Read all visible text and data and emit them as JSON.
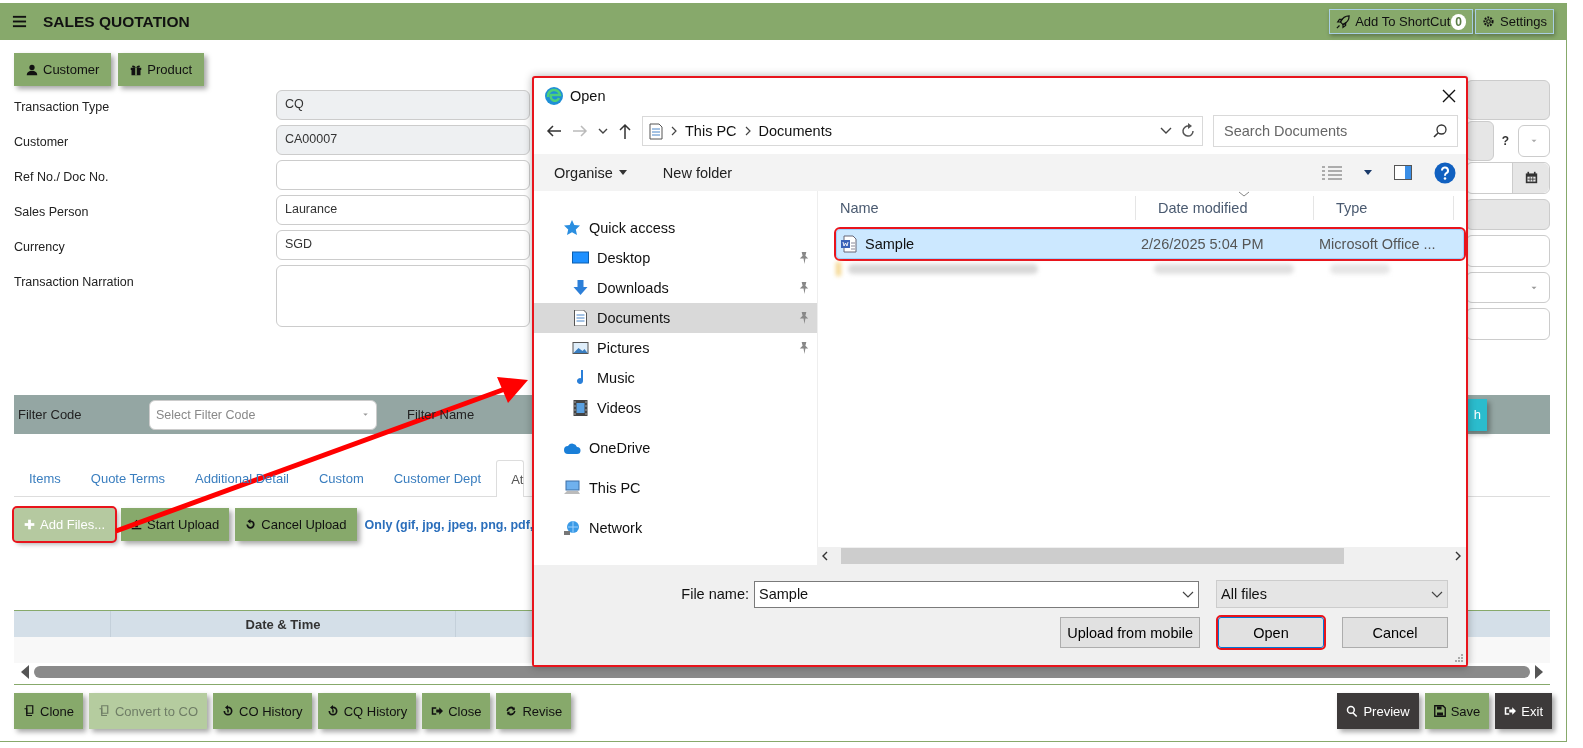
{
  "header": {
    "title": "SALES QUOTATION",
    "shortcut_label": "Add To ShortCut",
    "shortcut_count": "0",
    "settings_label": "Settings"
  },
  "top_buttons": [
    {
      "label": "Customer"
    },
    {
      "label": "Product"
    }
  ],
  "form": {
    "fields": [
      {
        "label": "Transaction Type",
        "value": "CQ",
        "readonly": true,
        "kind": "text"
      },
      {
        "label": "Customer",
        "value": "CA00007",
        "readonly": true,
        "kind": "text"
      },
      {
        "label": "Ref No./ Doc No.",
        "readonly": false,
        "kind": "text"
      },
      {
        "label": "Sales Person",
        "value": "Laurance",
        "readonly": false,
        "kind": "text"
      },
      {
        "label": "Currency",
        "value": "SGD",
        "readonly": false,
        "kind": "text"
      },
      {
        "label": "Transaction Narration",
        "readonly": false,
        "kind": "textarea"
      }
    ],
    "right_fields": [
      {
        "kind": "text",
        "readonly": true
      },
      {
        "kind": "help",
        "readonly": true,
        "help": "?"
      },
      {
        "kind": "date",
        "readonly": false
      },
      {
        "kind": "text",
        "readonly": true
      },
      {
        "kind": "text",
        "readonly": false
      },
      {
        "kind": "select",
        "readonly": false
      },
      {
        "kind": "text",
        "readonly": false
      }
    ]
  },
  "filter_bar": {
    "code_label": "Filter Code",
    "code_placeholder": "Select Filter Code",
    "name_label": "Filter Name",
    "search_button": "h"
  },
  "tabs": [
    {
      "label": "Items",
      "selected": false
    },
    {
      "label": "Quote Terms",
      "selected": false
    },
    {
      "label": "Additional Detail",
      "selected": false
    },
    {
      "label": "Custom",
      "selected": false
    },
    {
      "label": "Customer Dept",
      "selected": false
    },
    {
      "label": "At",
      "selected": true
    }
  ],
  "upload": {
    "buttons": [
      {
        "label": "Add Files...",
        "highlighted": true,
        "disabled": true
      },
      {
        "label": "Start Upload",
        "highlighted": false,
        "disabled": false
      },
      {
        "label": "Cancel Upload",
        "highlighted": false,
        "disabled": false
      }
    ],
    "note": "Only (gif, jpg, jpeg, png, pdf,"
  },
  "table": {
    "columns": [
      {
        "label": "Date & Time"
      }
    ]
  },
  "actions_left": [
    {
      "label": "Clone",
      "disabled": false
    },
    {
      "label": "Convert to CO",
      "disabled": true
    },
    {
      "label": "CO History",
      "disabled": false
    },
    {
      "label": "CQ History",
      "disabled": false
    },
    {
      "label": "Close",
      "disabled": false
    },
    {
      "label": "Revise",
      "disabled": false
    }
  ],
  "actions_right": [
    {
      "label": "Preview",
      "kind": "dark"
    },
    {
      "label": "Save",
      "kind": "green"
    },
    {
      "label": "Exit",
      "kind": "dark"
    }
  ],
  "callout_arrow": true,
  "dialog": {
    "title": "Open",
    "path": [
      "This PC",
      "Documents"
    ],
    "search_placeholder": "Search Documents",
    "organise": "Organise",
    "new_folder": "New folder",
    "nav": [
      {
        "label": "Quick access",
        "selected": false,
        "children": [
          {
            "label": "Desktop",
            "pinned": true,
            "selected": false
          },
          {
            "label": "Downloads",
            "pinned": true,
            "selected": false
          },
          {
            "label": "Documents",
            "pinned": true,
            "selected": true
          },
          {
            "label": "Pictures",
            "pinned": true,
            "selected": false
          },
          {
            "label": "Music",
            "pinned": false,
            "selected": false
          },
          {
            "label": "Videos",
            "pinned": false,
            "selected": false
          }
        ]
      },
      {
        "label": "OneDrive",
        "selected": false
      },
      {
        "label": "This PC",
        "selected": false
      },
      {
        "label": "Network",
        "selected": false
      }
    ],
    "columns": [
      "Name",
      "Date modified",
      "Type"
    ],
    "files": [
      {
        "kind": "file",
        "name": "Sample",
        "date": "2/26/2025 5:04 PM",
        "type": "Microsoft Office ...",
        "selected": true,
        "highlighted": true
      },
      {
        "kind": "blurred",
        "selected": false,
        "highlighted": false
      }
    ],
    "file_name_label": "File name:",
    "file_name": "Sample",
    "file_type": "All files",
    "buttons": [
      {
        "label": "Upload from mobile",
        "highlighted": false
      },
      {
        "label": "Open",
        "highlighted": true
      },
      {
        "label": "Cancel",
        "highlighted": false
      }
    ]
  }
}
